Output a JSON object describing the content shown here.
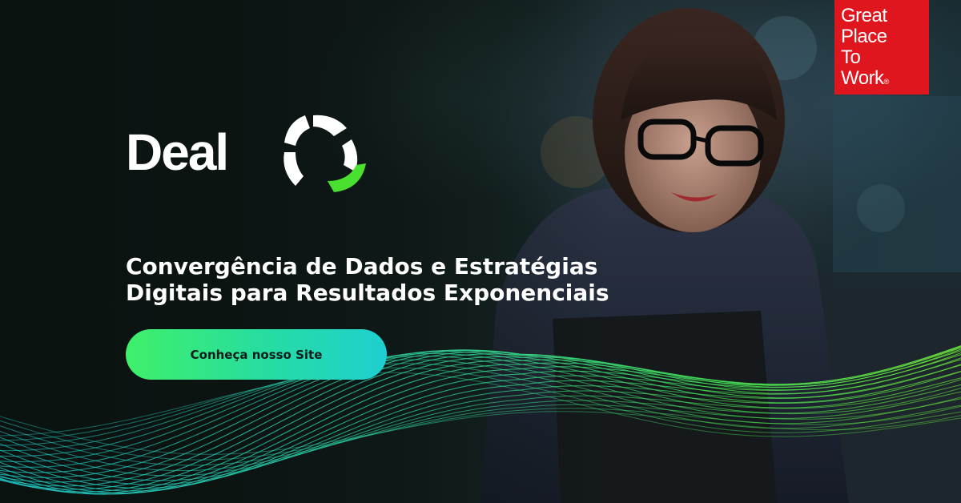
{
  "brand": {
    "name": "Deal",
    "accent_green": "#3ff06a",
    "accent_cyan": "#1ecfd0"
  },
  "headline": {
    "line1": "Convergência de Dados e Estratégias",
    "line2": "Digitais para Resultados Exponenciais"
  },
  "cta": {
    "label": "Conheça nosso Site"
  },
  "badge": {
    "line1": "Great",
    "line2": "Place",
    "line3": "To",
    "line4": "Work",
    "registered": "®",
    "color": "#e0161f"
  },
  "background": {
    "photo": "smiling-woman-with-glasses-holding-tablet",
    "decoration": "green-cyan-wave-lines"
  }
}
